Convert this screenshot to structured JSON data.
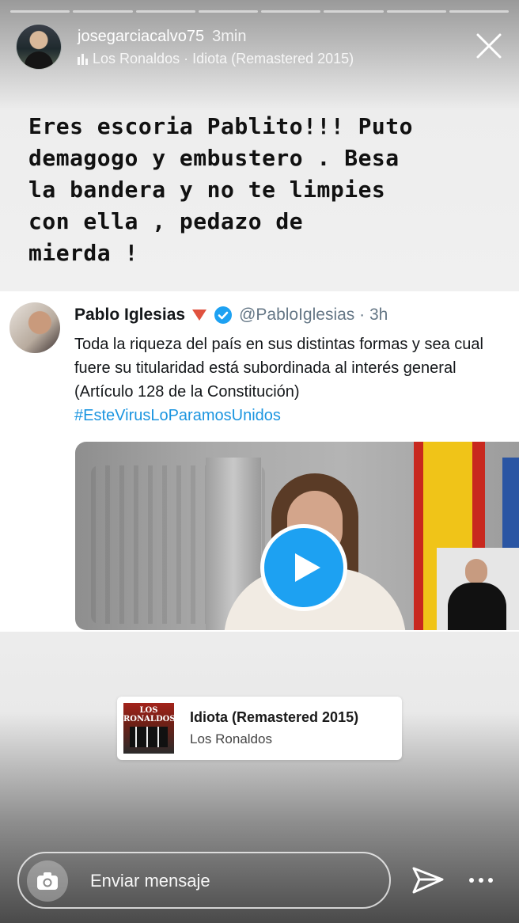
{
  "story": {
    "progress_segments": 8,
    "progress_completed": 0,
    "header": {
      "username": "josegarciacalvo75",
      "time": "3min",
      "music_line": "Los Ronaldos · Idiota (Remastered 2015)"
    },
    "caption": "Eres escoria Pablito!!! Puto\ndemagogo y embustero . Besa\nla bandera y no te limpies\ncon ella , pedazo de\nmierda !"
  },
  "tweet": {
    "name": "Pablo Iglesias",
    "handle_time": "@PabloIglesias · 3h",
    "text": "Toda la riqueza del país en sus distintas formas y sea cual fuere su titularidad está subordinada al interés general (Artículo 128 de la Constitución)",
    "hashtag": "#EsteVirusLoParamosUnidos",
    "video": {
      "play_icon": "play-icon"
    }
  },
  "music_sticker": {
    "title": "Idiota (Remastered 2015)",
    "artist": "Los Ronaldos",
    "album_logo": "LOS RONALDOS"
  },
  "footer": {
    "placeholder": "Enviar mensaje",
    "icons": {
      "camera": "camera-icon",
      "send": "send-icon",
      "more": "more-icon"
    }
  },
  "colors": {
    "twitter_blue": "#1b95e0",
    "play_blue": "#1da1f2"
  }
}
